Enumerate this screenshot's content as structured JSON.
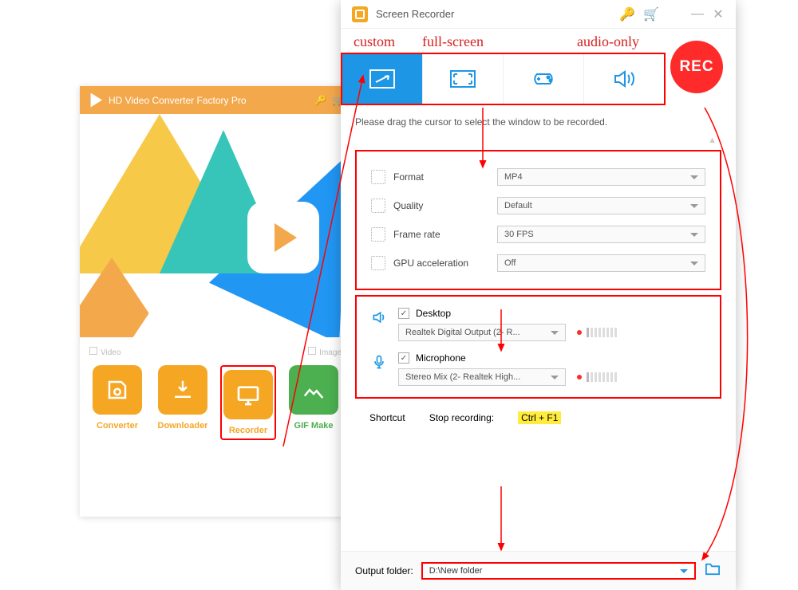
{
  "back": {
    "title": "HD Video Converter Factory Pro",
    "cat_video": "Video",
    "cat_image": "Image",
    "tiles": {
      "converter": "Converter",
      "downloader": "Downloader",
      "recorder": "Recorder",
      "gif": "GIF Make"
    }
  },
  "front": {
    "title": "Screen Recorder",
    "rec_label": "REC",
    "hint": "Please drag the cursor to select the window to be recorded.",
    "settings": {
      "format_label": "Format",
      "format_value": "MP4",
      "quality_label": "Quality",
      "quality_value": "Default",
      "framerate_label": "Frame rate",
      "framerate_value": "30 FPS",
      "gpu_label": "GPU acceleration",
      "gpu_value": "Off"
    },
    "audio": {
      "desktop_label": "Desktop",
      "desktop_device": "Realtek Digital Output (2- R...",
      "mic_label": "Microphone",
      "mic_device": "Stereo Mix (2- Realtek High..."
    },
    "shortcut_label": "Shortcut",
    "stop_label": "Stop recording:",
    "stop_key": "Ctrl + F1",
    "output_label": "Output folder:",
    "output_value": "D:\\New folder"
  },
  "annotations": {
    "custom": "custom",
    "fullscreen": "full-screen",
    "audioonly": "audio-only"
  }
}
